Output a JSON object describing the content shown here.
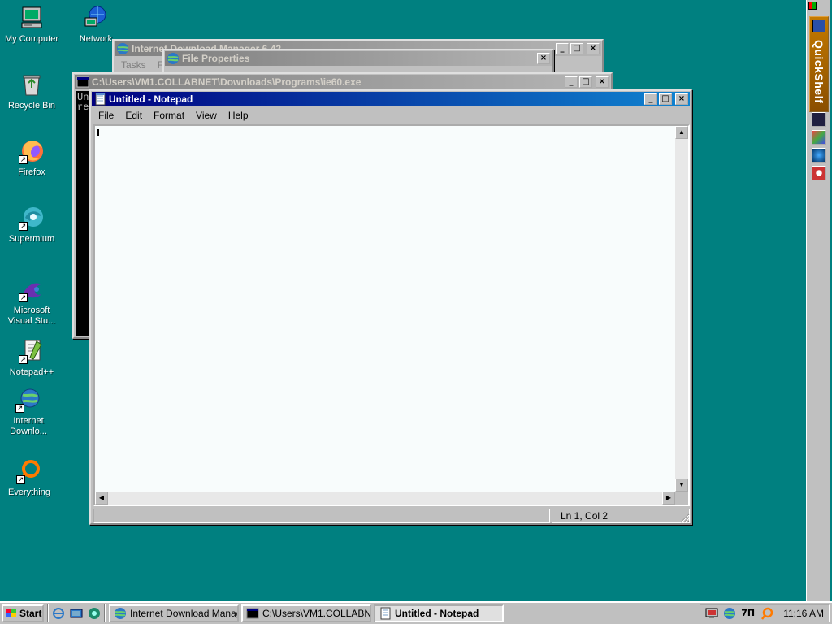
{
  "desktop": {
    "icons": [
      {
        "label": "My Computer",
        "name": "my-computer-icon"
      },
      {
        "label": "Network",
        "name": "network-icon"
      },
      {
        "label": "Recycle Bin",
        "name": "recycle-bin-icon"
      },
      {
        "label": "Firefox",
        "name": "firefox-icon"
      },
      {
        "label": "Supermium",
        "name": "supermium-icon"
      },
      {
        "label": "Microsoft Visual Stu...",
        "name": "visual-studio-icon"
      },
      {
        "label": "Notepad++",
        "name": "notepadpp-icon"
      },
      {
        "label": "Internet Downlo...",
        "name": "internet-download-manager-icon"
      },
      {
        "label": "Everything",
        "name": "everything-icon"
      }
    ]
  },
  "idm_window": {
    "title": "Internet Download Manager 6.42",
    "menu_partial": [
      "Tasks",
      "Fi"
    ]
  },
  "file_props_window": {
    "title": "File Properties"
  },
  "console_window": {
    "title": "C:\\Users\\VM1.COLLABNET\\Downloads\\Programs\\ie60.exe",
    "lines": [
      "Un",
      "re"
    ]
  },
  "notepad": {
    "title": "Untitled - Notepad",
    "menu": [
      "File",
      "Edit",
      "Format",
      "View",
      "Help"
    ],
    "content": "",
    "status": "Ln 1, Col 2"
  },
  "quickshelf": {
    "label": "QuickShelf"
  },
  "taskbar": {
    "start_label": "Start",
    "items": [
      {
        "label": "Internet Download Manag...",
        "active": false
      },
      {
        "label": "C:\\Users\\VM1.COLLABN...",
        "active": false
      },
      {
        "label": "Untitled - Notepad",
        "active": true
      }
    ],
    "clock": "11:16 AM"
  }
}
